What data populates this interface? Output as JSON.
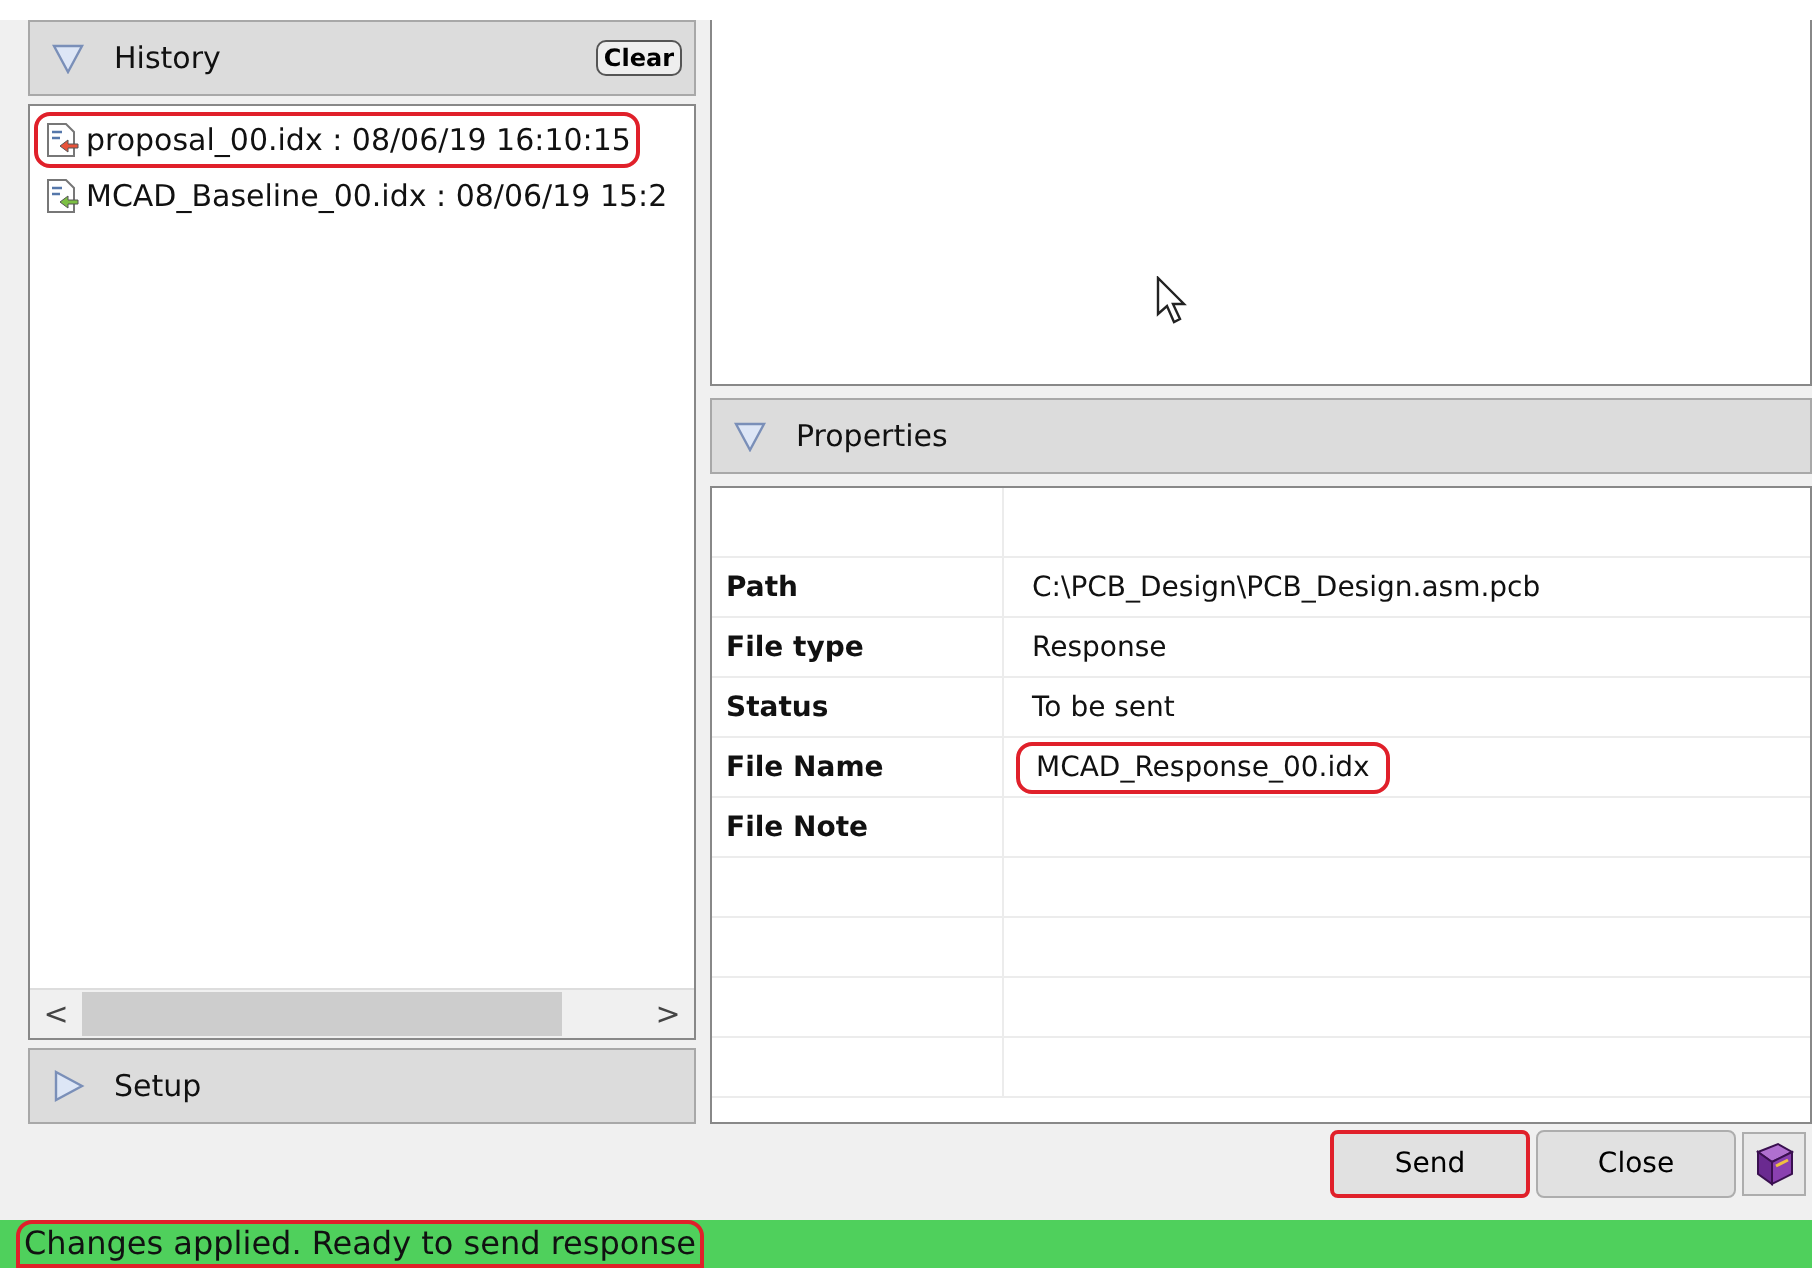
{
  "history": {
    "title": "History",
    "expanded": true,
    "clear_button": "Clear",
    "items": [
      {
        "label": "proposal_00.idx : 08/06/19 16:10:15",
        "kind": "outgoing",
        "highlighted": true
      },
      {
        "label": "MCAD_Baseline_00.idx : 08/06/19 15:2",
        "kind": "incoming",
        "highlighted": false
      }
    ],
    "scrollbar": {
      "left": "<",
      "right": ">"
    }
  },
  "setup": {
    "title": "Setup",
    "expanded": false
  },
  "properties": {
    "title": "Properties",
    "expanded": true,
    "rows": [
      {
        "label": "Path",
        "value": "C:\\PCB_Design\\PCB_Design.asm.pcb",
        "highlighted": false
      },
      {
        "label": "File type",
        "value": "Response",
        "highlighted": false
      },
      {
        "label": "Status",
        "value": "To be sent",
        "highlighted": false
      },
      {
        "label": "File Name",
        "value": "MCAD_Response_00.idx",
        "highlighted": true
      },
      {
        "label": "File Note",
        "highlighted": false
      }
    ]
  },
  "buttons": [
    {
      "label": "Send",
      "highlighted": true
    },
    {
      "label": "Close",
      "highlighted": false
    }
  ],
  "status_bar": {
    "text": "Changes applied. Ready to send response",
    "highlighted": true
  }
}
